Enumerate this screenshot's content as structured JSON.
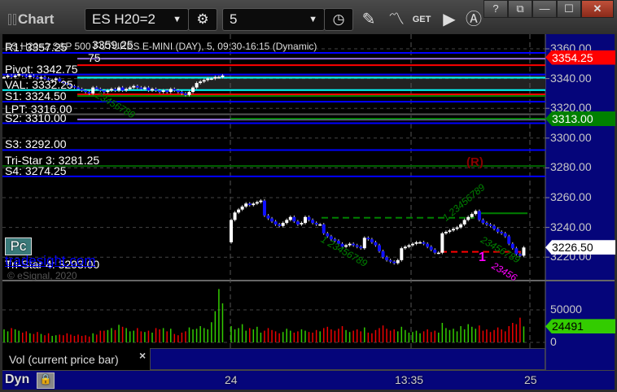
{
  "window": {
    "title": "Chart",
    "symbol": "ES H20=2",
    "interval": "5",
    "buttons": {
      "help": "?",
      "link": "link-window",
      "minimize": "minimize",
      "maximize": "maximize",
      "close": "close"
    }
  },
  "toolbar_icons": [
    "gear-icon",
    "clock-icon",
    "pencil-icon",
    "study-icon",
    "get-icon",
    "play-icon",
    "alert-icon"
  ],
  "chart": {
    "title": "ES H20=2 S&P 500 FUTURES E-MINI (DAY), 5, 09:30-16:15 (Dynamic)",
    "overlap_fragments": [
      "3359.25",
      "75",
      "00",
      "0"
    ],
    "levels": [
      {
        "label": "R1: 3357.25",
        "price": 3357.25,
        "color": "#0000ff"
      },
      {
        "label": "Pivot: 3342.75",
        "price": 3342.75,
        "color": "#0000ff"
      },
      {
        "label": "VAL: 3332.25",
        "price": 3332.25,
        "color": "#00ffff"
      },
      {
        "label": "S1: 3324.50",
        "price": 3324.5,
        "color": "#0000ff"
      },
      {
        "label": "LPT: 3316.00",
        "price": 3316.0,
        "color": "#555555"
      },
      {
        "label": "S2: 3310.00",
        "price": 3310.0,
        "color": "#0000ff"
      },
      {
        "label": "S3: 3292.00",
        "price": 3292.0,
        "color": "#0000ff"
      },
      {
        "label": "Tri-Star 3: 3281.25",
        "price": 3281.25,
        "color": "#006400"
      },
      {
        "label": "S4: 3274.25",
        "price": 3274.25,
        "color": "#0000ff"
      },
      {
        "label": "Tri-Star 4: 3203.00",
        "price": 3203.0,
        "color": "#0000ff"
      }
    ],
    "extra_lines": [
      {
        "price": 3353.4,
        "color": "#9370db"
      },
      {
        "price": 3349,
        "color": "#ff0000"
      },
      {
        "price": 3340.6,
        "color": "#00ffff"
      },
      {
        "price": 3329.4,
        "color": "#ff0000"
      },
      {
        "price": 3328.3,
        "color": "#008000"
      },
      {
        "price": 3312.5,
        "color": "#9370db"
      }
    ],
    "price_ticks": [
      3360,
      3340,
      3320,
      3300,
      3280,
      3260,
      3240,
      3220
    ],
    "price_tags": [
      {
        "value": "3354.25",
        "price": 3354.25,
        "bg": "#ff0000",
        "fg": "#ffffff"
      },
      {
        "value": "3313.00",
        "price": 3313.0,
        "bg": "#008000",
        "fg": "#ffffff"
      },
      {
        "value": "3226.50",
        "price": 3226.5,
        "bg": "#ffffff",
        "fg": "#000000"
      }
    ],
    "day1_closes": [
      3341,
      3342,
      3341,
      3342,
      3343,
      3342,
      3341,
      3342,
      3341,
      3340,
      3341,
      3340,
      3339,
      3339,
      3340,
      3338,
      3337,
      3336,
      3335,
      3334,
      3333,
      3332,
      3331,
      3330,
      3334,
      3333,
      3332,
      3331,
      3332,
      3333,
      3332,
      3334,
      3332,
      3333,
      3334,
      3335,
      3334,
      3333,
      3334,
      3332,
      3333,
      3332,
      3331,
      3332,
      3331,
      3333,
      3332,
      3331,
      3330,
      3329,
      3331,
      3334,
      3337,
      3338,
      3339,
      3340,
      3340,
      3341,
      3341,
      3342
    ],
    "day2_open": 3230,
    "day2_closes": [
      3245,
      3250,
      3252,
      3254,
      3256,
      3255,
      3256,
      3257,
      3258,
      3248,
      3246,
      3244,
      3242,
      3241,
      3243,
      3245,
      3247,
      3244,
      3242,
      3243,
      3247,
      3245,
      3243,
      3242,
      3242,
      3236,
      3234,
      3232,
      3231,
      3229,
      3227,
      3228,
      3229,
      3228,
      3227,
      3226,
      3233,
      3232,
      3230,
      3228,
      3224,
      3220,
      3218,
      3217,
      3216,
      3218,
      3226,
      3227,
      3228,
      3229,
      3230,
      3230,
      3229,
      3227,
      3225,
      3223,
      3223,
      3236,
      3237,
      3238,
      3239,
      3240,
      3242,
      3245,
      3247,
      3249,
      3251,
      3245,
      3243,
      3242,
      3241,
      3239,
      3237,
      3236,
      3234,
      3229,
      3226,
      3222,
      3221,
      3226.5
    ],
    "support_lines": [
      {
        "price": 3313.0,
        "color": "#008000",
        "style": "solid"
      },
      {
        "price": 3246.5,
        "color": "#008000",
        "style": "dashed"
      },
      {
        "price": 3249.5,
        "color": "#008000",
        "style": "solid"
      },
      {
        "price": 3223.6,
        "color": "#ff0000",
        "style": "dashed"
      }
    ],
    "annotations": [
      {
        "text": "23456789",
        "color": "#008000"
      },
      {
        "text": "1 23456789",
        "color": "#008000"
      },
      {
        "text": "1 23456789",
        "color": "#008000"
      },
      {
        "text": "23456789",
        "color": "#008000"
      },
      {
        "text": "(R)",
        "color": "#8b0000"
      },
      {
        "text": "1",
        "color": "#ff00ff"
      },
      {
        "text": "23456",
        "color": "#ff00ff"
      }
    ],
    "pc_button": "Pc",
    "link": "tradesight.com",
    "watermark": "© eSignal, 2020"
  },
  "volume": {
    "legend": "Vol (current price bar)",
    "close_glyph": "×",
    "ticks": [
      "50000",
      "0"
    ],
    "current": "24491",
    "current_color": "#33cc00",
    "day1": [
      20000,
      17000,
      22000,
      20000,
      18000,
      15000,
      17000,
      14000,
      13000,
      16000,
      13000,
      11000,
      14000,
      10000,
      11000,
      12000,
      11000,
      14000,
      12000,
      10000,
      12000,
      10000,
      11000,
      9000,
      14000,
      12000,
      18000,
      18000,
      19000,
      22000,
      19000,
      27000,
      24000,
      22000,
      17000,
      18000,
      22000,
      17000,
      16000,
      18000,
      15000,
      22000,
      20000,
      22000,
      17000,
      21000,
      13000,
      11000,
      15000,
      17000,
      23000,
      20000,
      21000,
      25000,
      22000,
      20000,
      31000,
      48000,
      82000,
      60000
    ],
    "day2": [
      25000,
      20000,
      22000,
      28000,
      18000,
      22000,
      20000,
      24000,
      15000,
      18000,
      22000,
      19000,
      17000,
      14000,
      16000,
      21000,
      18000,
      15000,
      17000,
      20000,
      18000,
      16000,
      15000,
      19000,
      17000,
      22000,
      24000,
      20000,
      18000,
      21000,
      25000,
      19000,
      16000,
      18000,
      20000,
      17000,
      23000,
      15000,
      14000,
      19000,
      22000,
      26000,
      21000,
      18000,
      20000,
      17000,
      24000,
      19000,
      15000,
      16000,
      18000,
      14000,
      17000,
      20000,
      16000,
      18000,
      15000,
      30000,
      22000,
      19000,
      21000,
      17000,
      25000,
      20000,
      28000,
      24000,
      21000,
      26000,
      18000,
      20000,
      16000,
      19000,
      23000,
      20000,
      17000,
      25000,
      30000,
      28000,
      38000,
      24491
    ]
  },
  "time_axis": {
    "labels": [
      "24",
      "13:35",
      "25"
    ]
  },
  "status": {
    "mode": "Dyn",
    "lock_icon": "lock-clock-icon"
  }
}
